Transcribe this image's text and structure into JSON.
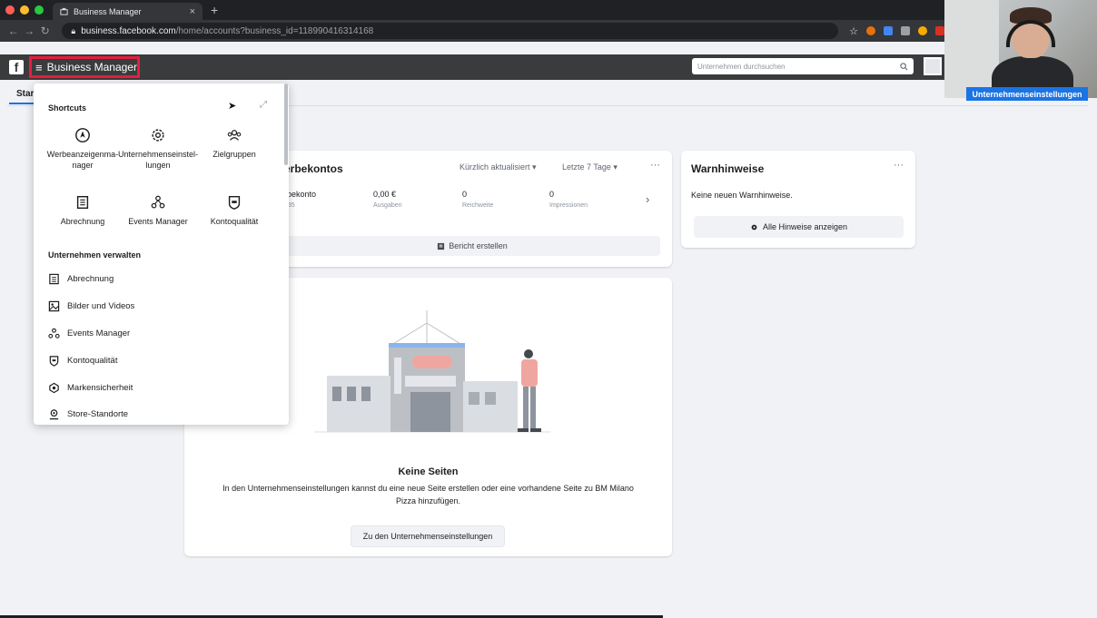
{
  "browser": {
    "tab_title": "Business Manager",
    "tab_close": "×",
    "new_tab": "+",
    "url_host": "business.facebook.com",
    "url_path": "/home/accounts?business_id=118990416314168",
    "dot_colors": [
      "#ff5f57",
      "#febc2e",
      "#28c840"
    ]
  },
  "fbbar": {
    "logo": "f",
    "title": "Business Manager",
    "search_placeholder": "Unternehmen durchsuchen"
  },
  "webcam": {
    "settings_button": "Unternehmenseinstellungen"
  },
  "page": {
    "tab_label": "Star"
  },
  "ads_card": {
    "title": "erbekontos",
    "filter_recent": "Kürzlich aktualisiert ▾",
    "filter_range": "Letzte 7 Tage ▾",
    "more": "···",
    "account_name": "rbekonto",
    "account_id": "635",
    "metrics": [
      {
        "value": "0,00 €",
        "label": "Ausgaben"
      },
      {
        "value": "0",
        "label": "Reichweite"
      },
      {
        "value": "0",
        "label": "Impressionen"
      }
    ],
    "chevron": "›",
    "report_button": "Bericht erstellen"
  },
  "warn_card": {
    "title": "Warnhinweise",
    "more": "···",
    "text": "Keine neuen Warnhinweise.",
    "button": "Alle Hinweise anzeigen"
  },
  "pages_card": {
    "title": "Keine Seiten",
    "description": "In den Unternehmenseinstellungen kannst du eine neue Seite erstellen oder eine vorhandene Seite zu BM Milano Pizza hinzufügen.",
    "button": "Zu den Unternehmenseinstellungen"
  },
  "menu": {
    "shortcuts_heading": "Shortcuts",
    "shortcuts": [
      {
        "label": "Werbeanzeigenma- nager",
        "icon": "compass-icon"
      },
      {
        "label": "Unternehmenseinstel- lungen",
        "icon": "gear-icon"
      },
      {
        "label": "Zielgruppen",
        "icon": "people-icon"
      },
      {
        "label": "Abrechnung",
        "icon": "receipt-icon"
      },
      {
        "label": "Events Manager",
        "icon": "events-icon"
      },
      {
        "label": "Kontoqualität",
        "icon": "shield-icon"
      }
    ],
    "manage_heading": "Unternehmen verwalten",
    "items": [
      {
        "label": "Abrechnung",
        "icon": "receipt-icon"
      },
      {
        "label": "Bilder und Videos",
        "icon": "media-icon"
      },
      {
        "label": "Events Manager",
        "icon": "events-icon"
      },
      {
        "label": "Kontoqualität",
        "icon": "shield-icon"
      },
      {
        "label": "Markensicherheit",
        "icon": "brand-safety-icon"
      },
      {
        "label": "Store-Standorte",
        "icon": "location-icon"
      }
    ]
  },
  "colors": {
    "accent": "#1b74e4",
    "highlight": "#e41e3f",
    "fb_bar": "#3a3b3c"
  }
}
